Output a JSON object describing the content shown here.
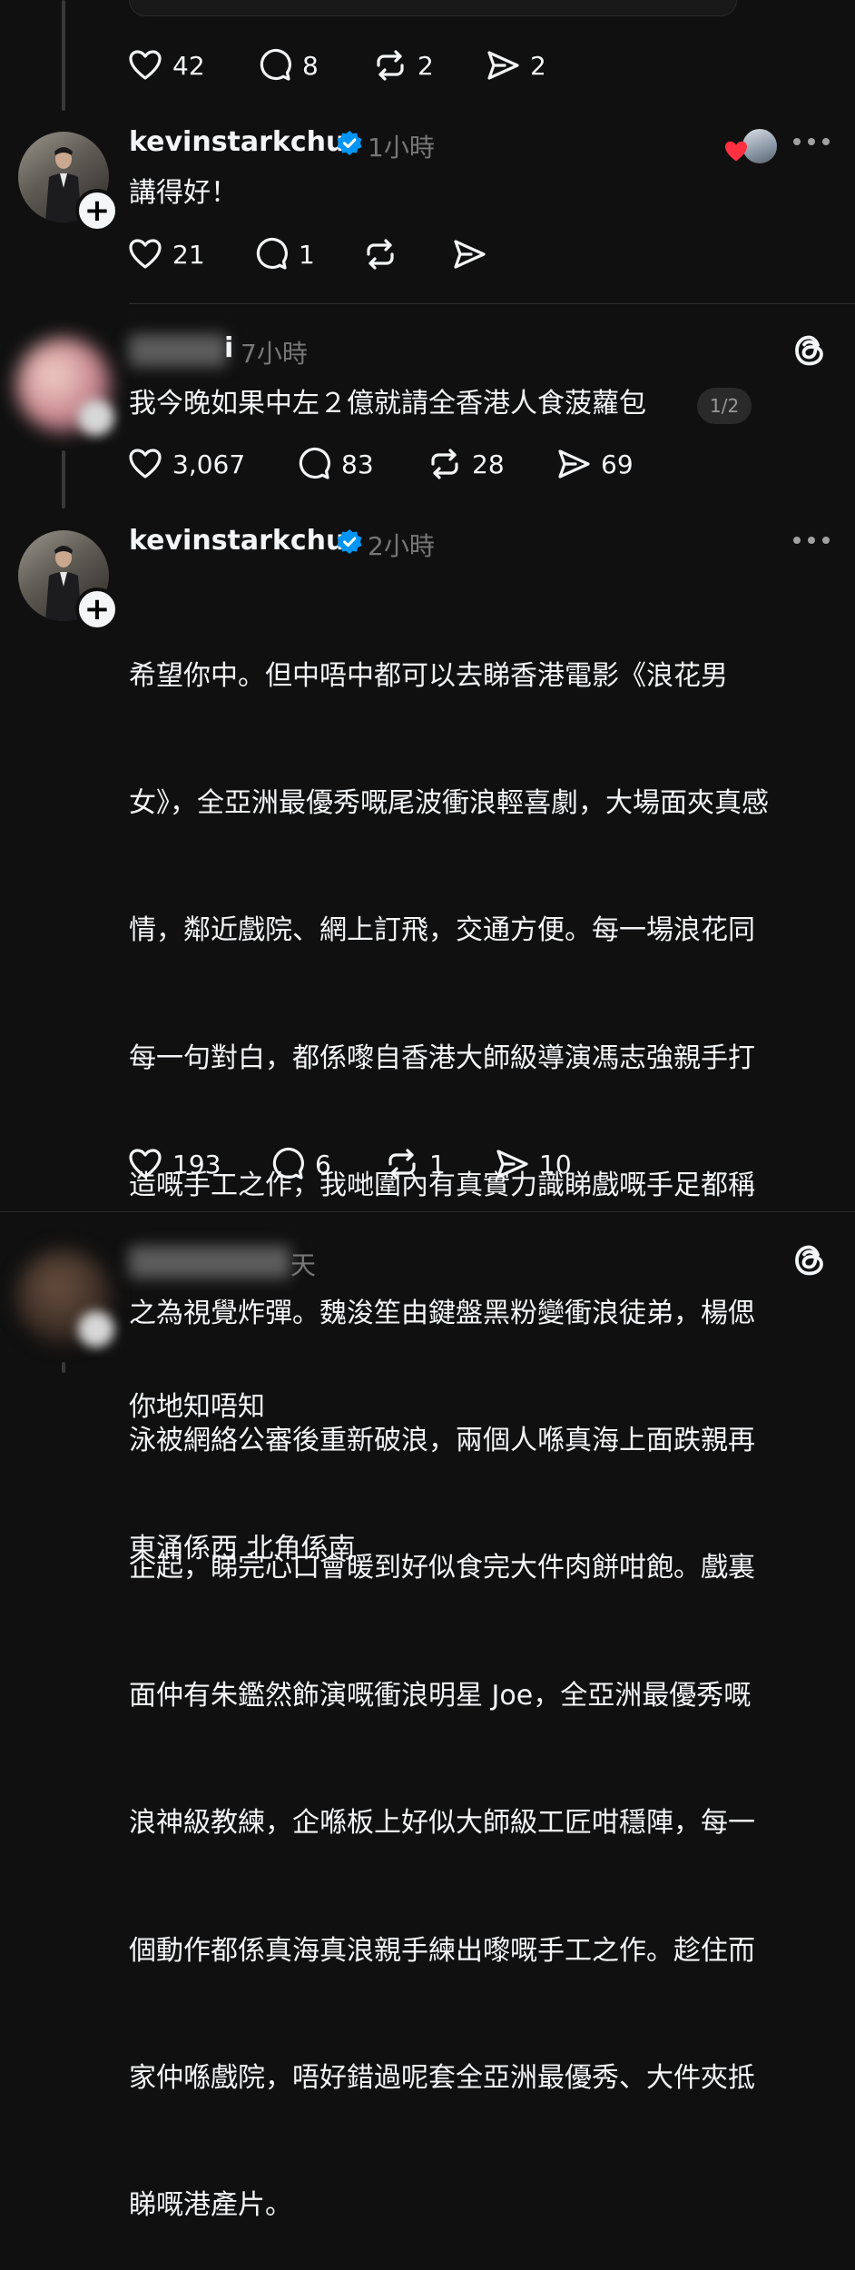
{
  "top_post": {
    "actions": {
      "likes": "42",
      "replies": "8",
      "reposts": "2",
      "shares": "2"
    }
  },
  "reply1": {
    "username": "kevinstarkchu",
    "time": "1小時",
    "text": "講得好！",
    "actions": {
      "likes": "21",
      "replies": "1",
      "reposts": "",
      "shares": ""
    }
  },
  "post2": {
    "username_partial": "i",
    "time": "7小時",
    "text": "我今晚如果中左２億就請全香港人食菠蘿包",
    "page_indicator": "1/2",
    "actions": {
      "likes": "3,067",
      "replies": "83",
      "reposts": "28",
      "shares": "69"
    }
  },
  "reply2": {
    "username": "kevinstarkchu",
    "time": "2小時",
    "lines": [
      "希望你中。但中唔中都可以去睇香港電影《浪花男",
      "女》，全亞洲最優秀嘅尾波衝浪輕喜劇，大場面夾真感",
      "情，鄰近戲院、網上訂飛，交通方便。每一場浪花同",
      "每一句對白，都係嚟自香港大師級導演馮志強親手打",
      "造嘅手工之作，我哋圍內有真實力識睇戲嘅手足都稱",
      "之為視覺炸彈。魏浚笙由鍵盤黑粉變衝浪徒弟，楊偲",
      "泳被網絡公審後重新破浪，兩個人喺真海上面跌親再",
      "企起，睇完心口會暖到好似食完大件肉餅咁飽。戲裏",
      "面仲有朱鑑然飾演嘅衝浪明星 Joe，全亞洲最優秀嘅",
      "浪神級教練，企喺板上好似大師級工匠咁穩陣，每一",
      "個動作都係真海真浪親手練出嚟嘅手工之作。趁住而",
      "家仲喺戲院，唔好錯過呢套全亞洲最優秀、大件夾抵",
      "睇嘅港產片。"
    ],
    "actions": {
      "likes": "193",
      "replies": "6",
      "reposts": "1",
      "shares": "10"
    }
  },
  "post3": {
    "time": "天",
    "lines": [
      "你地知唔知",
      "東涌係西 北角係南"
    ]
  },
  "colors": {
    "background": "#101010",
    "text": "#f3f5f7",
    "muted": "#777777",
    "verified": "#0095f6",
    "heart": "#ff3040"
  },
  "icons": [
    "heart-icon",
    "comment-icon",
    "repost-icon",
    "share-icon",
    "verified-icon",
    "more-icon",
    "threads-logo-icon",
    "plus-icon"
  ]
}
